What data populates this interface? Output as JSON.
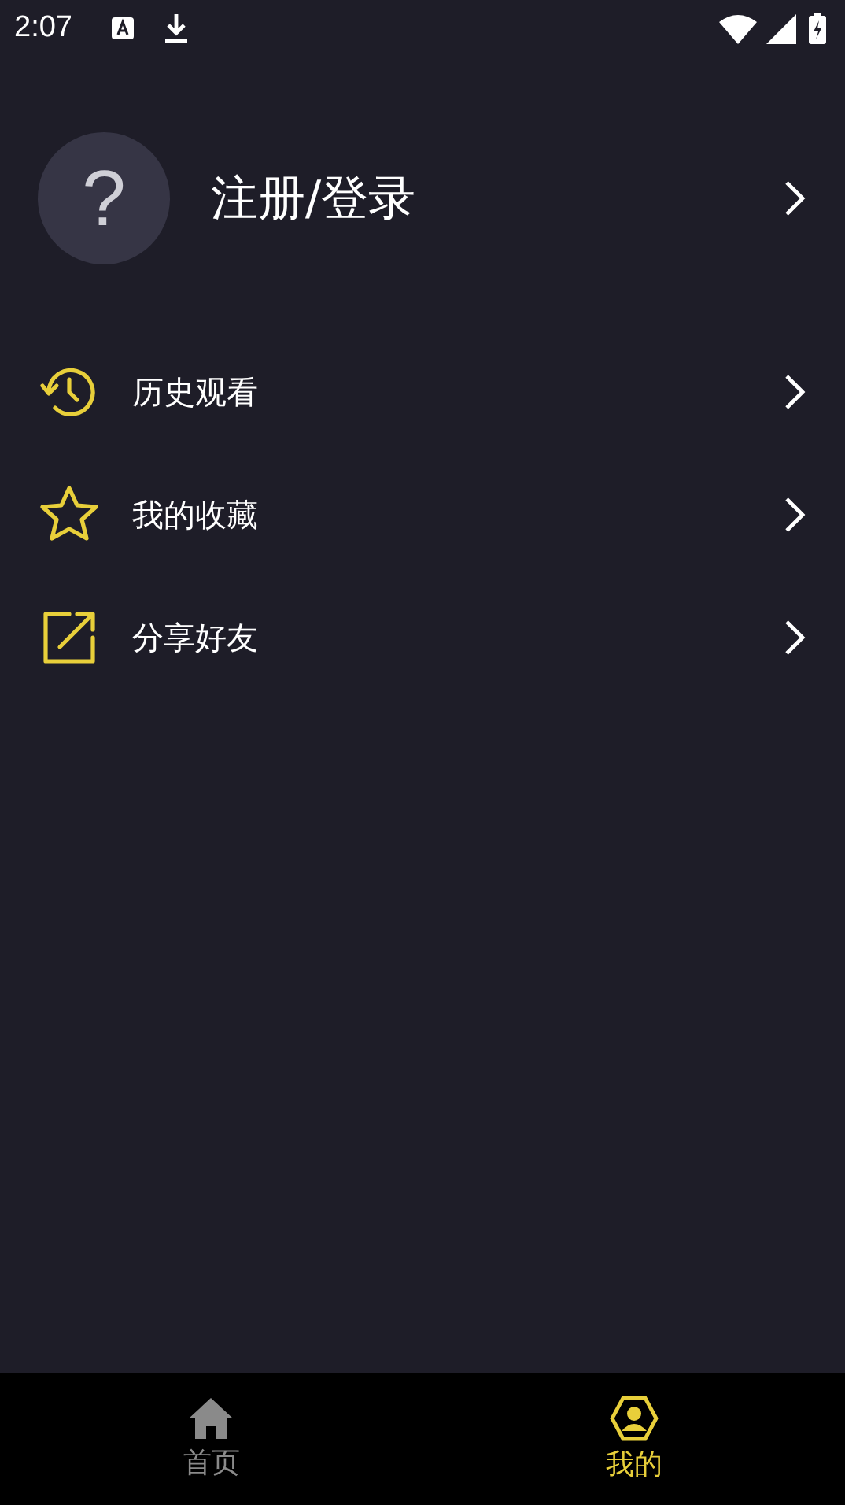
{
  "status_bar": {
    "time": "2:07"
  },
  "profile": {
    "label": "注册/登录",
    "avatar_glyph": "?"
  },
  "menu": [
    {
      "kind": "history",
      "label": "历史观看"
    },
    {
      "kind": "star",
      "label": "我的收藏"
    },
    {
      "kind": "share",
      "label": "分享好友"
    }
  ],
  "tabs": [
    {
      "kind": "home",
      "label": "首页",
      "selected": false
    },
    {
      "kind": "me",
      "label": "我的",
      "selected": true
    }
  ]
}
